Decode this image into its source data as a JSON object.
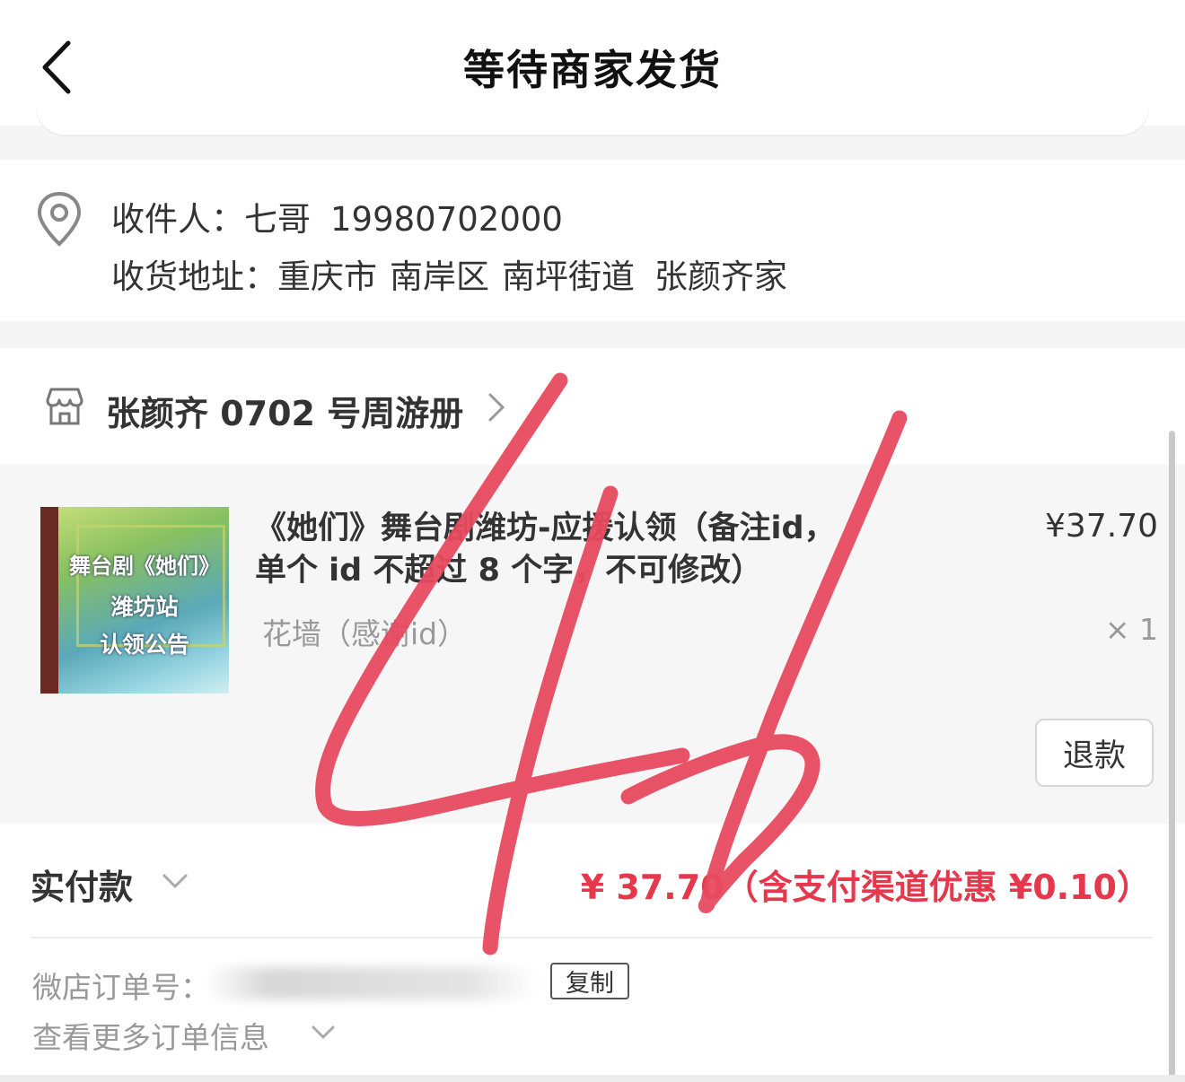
{
  "header": {
    "title": "等待商家发货",
    "back_icon": "chevron-left-icon"
  },
  "address": {
    "icon": "location-pin-icon",
    "recipient_label": "收件人：",
    "recipient_name": "七哥",
    "recipient_phone": "19980702000",
    "address_label": "收货地址：",
    "city": "重庆市",
    "district": "南岸区",
    "street": "南坪街道",
    "detail": "张颜齐家"
  },
  "shop": {
    "icon": "store-icon",
    "name": "张颜齐 0702 号周游册"
  },
  "product": {
    "thumbnail_text": [
      "舞台剧《她们》",
      "潍坊站",
      "认领公告"
    ],
    "title": "《她们》舞台剧潍坊-应援认领（备注id，单个 id 不超过 8 个字，不可修改）",
    "spec": "花墙（感谢id）",
    "price": "¥37.70",
    "quantity": "× 1",
    "refund_label": "退款"
  },
  "payment": {
    "label": "实付款",
    "amount": "¥ 37.70（含支付渠道优惠 ¥0.10）",
    "order_no_label": "微店订单号：",
    "copy_label": "复制",
    "more_info_label": "查看更多订单信息"
  },
  "overlay": {
    "handwriting": "4b",
    "color": "#e84a5f"
  },
  "colors": {
    "accent": "#e5384c",
    "muted": "#999999"
  }
}
